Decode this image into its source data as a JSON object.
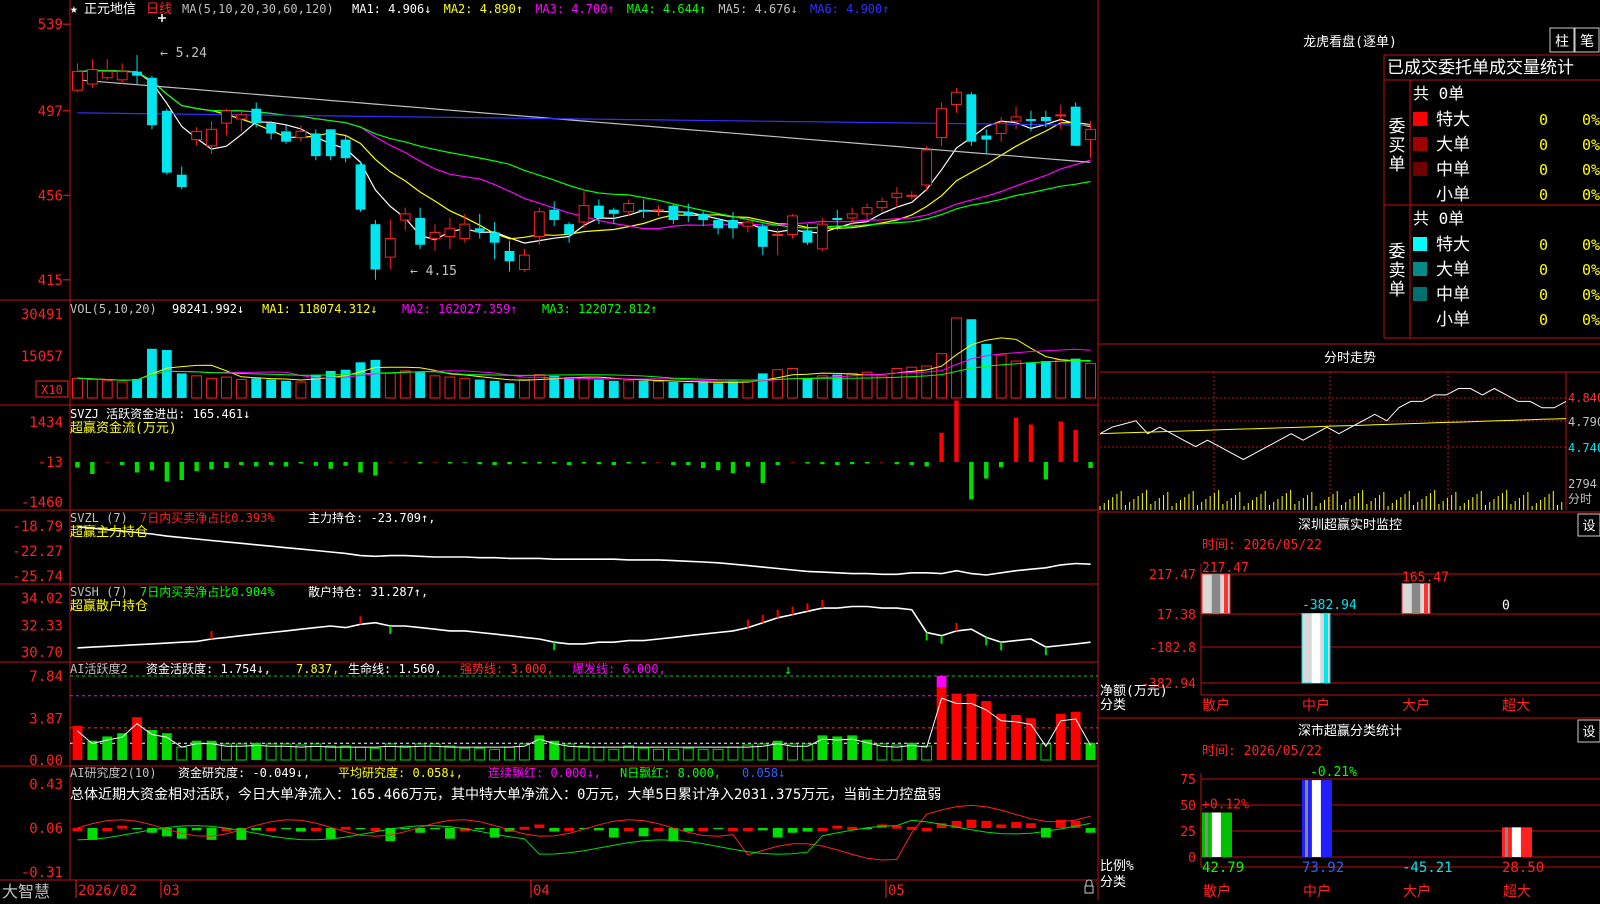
{
  "colors": {
    "bg": "#000000",
    "grid": "#c01010",
    "up": "#ff2020",
    "down": "#00e5ee",
    "text": "#c0c0c0",
    "yellow": "#ffff00",
    "white": "#ffffff",
    "green": "#00ff00",
    "magenta": "#ff00ff",
    "blue": "#3030ff"
  },
  "main": {
    "stock_name": "正元地信",
    "period": "日线",
    "ma_label": "MA(5,10,20,30,60,120)",
    "ma_values": [
      {
        "label": "MA1:",
        "value": "4.906",
        "arrow": "↓",
        "color": "#ffffff"
      },
      {
        "label": "MA2:",
        "value": "4.890",
        "arrow": "↑",
        "color": "#ffff00"
      },
      {
        "label": "MA3:",
        "value": "4.700",
        "arrow": "↑",
        "color": "#ff00ff"
      },
      {
        "label": "MA4:",
        "value": "4.644",
        "arrow": "↑",
        "color": "#00ff00"
      },
      {
        "label": "MA5:",
        "value": "4.676",
        "arrow": "↓",
        "color": "#c0c0c0"
      },
      {
        "label": "MA6:",
        "value": "4.900",
        "arrow": "↑",
        "color": "#3030ff"
      }
    ],
    "y_ticks": [
      "539",
      "497",
      "456",
      "415"
    ],
    "high_label": "5.24",
    "low_label": "4.15"
  },
  "vol": {
    "title": "VOL(5,10,20)",
    "value": "98241.992",
    "arrow": "↓",
    "ma1": "MA1: 118074.312",
    "ma1_arrow": "↓",
    "ma2": "MA2: 162027.359",
    "ma2_arrow": "↑",
    "ma3": "MA3: 122072.812",
    "ma3_arrow": "↑",
    "y_ticks": [
      "30491",
      "15057"
    ],
    "unit": "X10"
  },
  "svzj": {
    "title": "SVZJ  活跃资金进出: 165.461",
    "arrow": "↓",
    "subtitle": "超赢资金流(万元)",
    "y_ticks": [
      "1434",
      "-13",
      "-1460"
    ]
  },
  "svzl": {
    "title": "SVZL (7)",
    "part1": "7日内买卖净占比0.393%",
    "part2": "主力持仓: -23.709",
    "arrow": "↑,",
    "subtitle": "超赢主力持仓",
    "y_ticks": [
      "-18.79",
      "-22.27",
      "-25.74"
    ]
  },
  "svsh": {
    "title": "SVSH (7)",
    "part1": "7日内买卖净占比0.904%",
    "part2": "散户持仓: 31.287",
    "arrow": "↑,",
    "subtitle": "超赢散户持仓",
    "y_ticks": [
      "34.02",
      "32.33",
      "30.70"
    ]
  },
  "ai1": {
    "title": "AI活跃度2",
    "p1": "资金活跃度: 1.754",
    "a1": "↓,",
    "p2": "7.837,",
    "p3": "生命线: 1.560,",
    "p4": "强势线: 3.000,",
    "p5": "爆发线: 6.000,",
    "y_ticks": [
      "7.84",
      "3.87",
      "0.00"
    ]
  },
  "ai2": {
    "title": "AI研究度2(10)",
    "p1": "资金研究度: -0.049",
    "a1": "↓,",
    "p2": "平均研究度: 0.058",
    "a2": "↓,",
    "p3": "连续飘红: 0.000",
    "a3": "↓,",
    "p4": "N日飘红: 8.000,",
    "p5": "0.058",
    "a5": "↓",
    "summary": "总体近期大资金相对活跃，今日大单净流入：165.466万元，其中特大单净流入：0万元，大单5日累计净入2031.375万元，当前主力控盘弱",
    "y_ticks": [
      "0.43",
      "0.06",
      "-0.31"
    ]
  },
  "xaxis": {
    "brand": "大智慧",
    "labels": [
      "2026/02",
      "03",
      "04",
      "05"
    ]
  },
  "right": {
    "lhb_title": "龙虎看盘(逐单)",
    "tab_bar": "柱",
    "tab_note": "笔",
    "stats_title": "已成交委托单成交量统计",
    "buy": {
      "label": "委买单",
      "total": "共 0单",
      "rows": [
        {
          "name": "特大",
          "value": "0",
          "pct": "0%",
          "color": "#ff0000"
        },
        {
          "name": "大单",
          "value": "0",
          "pct": "0%",
          "color": "#a00000"
        },
        {
          "name": "中单",
          "value": "0",
          "pct": "0%",
          "color": "#700000"
        },
        {
          "name": "小单",
          "value": "0",
          "pct": "0%",
          "color": "#000000"
        }
      ]
    },
    "sell": {
      "label": "委卖单",
      "total": "共 0单",
      "rows": [
        {
          "name": "特大",
          "value": "0",
          "pct": "0%",
          "color": "#00ffff"
        },
        {
          "name": "大单",
          "value": "0",
          "pct": "0%",
          "color": "#008b8b"
        },
        {
          "name": "中单",
          "value": "0",
          "pct": "0%",
          "color": "#006f6f"
        },
        {
          "name": "小单",
          "value": "0",
          "pct": "0%",
          "color": "#000000"
        }
      ]
    },
    "fenshi": {
      "title": "分时走势",
      "y_ticks": [
        "4.840",
        "4.790",
        "4.740"
      ],
      "vol_tick": "2794",
      "vol_unit": "分时"
    },
    "monitor": {
      "title": "深圳超赢实时监控",
      "settings": "设",
      "date": "时间: 2026/05/22",
      "y_ticks": [
        "217.47",
        "17.38",
        "-182.8",
        "-382.94"
      ],
      "ylabel": "净额(万元)",
      "xlabel": "分类",
      "bars": [
        {
          "name": "散户",
          "value": 217.47,
          "label": "217.47"
        },
        {
          "name": "中户",
          "value": -382.94,
          "label": "-382.94"
        },
        {
          "name": "大户",
          "value": 165.47,
          "label": "165.47"
        },
        {
          "name": "超大",
          "value": 0,
          "label": "0"
        }
      ]
    },
    "classify": {
      "title": "深市超赢分类统计",
      "settings": "设",
      "date": "时间: 2026/05/22",
      "y_ticks": [
        "75",
        "50",
        "25",
        "0"
      ],
      "ylabel": "比例%",
      "xlabel": "分类",
      "bars": [
        {
          "name": "散户",
          "value": 42.79,
          "label": "42.79",
          "top": "+0.12%"
        },
        {
          "name": "中户",
          "value": 73.92,
          "label": "73.92",
          "top": "-0.21%"
        },
        {
          "name": "大户",
          "value": -45.21,
          "label": "-45.21",
          "top": ""
        },
        {
          "name": "超大",
          "value": 28.5,
          "label": "28.50",
          "top": ""
        }
      ]
    }
  },
  "chart_data": {
    "type": "candlestick",
    "title": "正元地信 日线",
    "ylim": [
      4.15,
      5.39
    ],
    "candles": [
      [
        5.07,
        5.16,
        5.2,
        5.06
      ],
      [
        5.1,
        5.17,
        5.22,
        5.08
      ],
      [
        5.13,
        5.16,
        5.22,
        5.12
      ],
      [
        5.12,
        5.16,
        5.2,
        5.1
      ],
      [
        5.16,
        5.14,
        5.24,
        5.1
      ],
      [
        5.13,
        4.9,
        5.14,
        4.88
      ],
      [
        4.97,
        4.67,
        4.98,
        4.66
      ],
      [
        4.66,
        4.6,
        4.7,
        4.59
      ],
      [
        4.83,
        4.87,
        4.89,
        4.8
      ],
      [
        4.8,
        4.88,
        4.92,
        4.76
      ],
      [
        4.91,
        4.97,
        4.98,
        4.85
      ],
      [
        4.93,
        4.95,
        4.97,
        4.87
      ],
      [
        4.98,
        4.91,
        5.01,
        4.89
      ],
      [
        4.91,
        4.86,
        4.92,
        4.83
      ],
      [
        4.87,
        4.82,
        4.9,
        4.81
      ],
      [
        4.84,
        4.87,
        4.9,
        4.82
      ],
      [
        4.86,
        4.75,
        4.88,
        4.73
      ],
      [
        4.88,
        4.75,
        4.88,
        4.73
      ],
      [
        4.83,
        4.74,
        4.85,
        4.72
      ],
      [
        4.71,
        4.49,
        4.72,
        4.48
      ],
      [
        4.42,
        4.2,
        4.44,
        4.15
      ],
      [
        4.26,
        4.35,
        4.44,
        4.2
      ],
      [
        4.44,
        4.47,
        4.5,
        4.39
      ],
      [
        4.45,
        4.32,
        4.5,
        4.3
      ],
      [
        4.35,
        4.38,
        4.42,
        4.29
      ],
      [
        4.36,
        4.4,
        4.45,
        4.3
      ],
      [
        4.35,
        4.42,
        4.47,
        4.33
      ],
      [
        4.4,
        4.38,
        4.47,
        4.35
      ],
      [
        4.38,
        4.33,
        4.43,
        4.25
      ],
      [
        4.29,
        4.24,
        4.34,
        4.19
      ],
      [
        4.2,
        4.27,
        4.3,
        4.19
      ],
      [
        4.36,
        4.48,
        4.5,
        4.32
      ],
      [
        4.49,
        4.44,
        4.53,
        4.41
      ],
      [
        4.42,
        4.37,
        4.43,
        4.33
      ],
      [
        4.43,
        4.51,
        4.58,
        4.4
      ],
      [
        4.51,
        4.45,
        4.54,
        4.42
      ],
      [
        4.49,
        4.47,
        4.5,
        4.42
      ],
      [
        4.48,
        4.52,
        4.54,
        4.46
      ],
      [
        4.49,
        4.48,
        4.54,
        4.45
      ],
      [
        4.49,
        4.49,
        4.51,
        4.46
      ],
      [
        4.51,
        4.44,
        4.52,
        4.42
      ],
      [
        4.48,
        4.46,
        4.52,
        4.43
      ],
      [
        4.47,
        4.44,
        4.48,
        4.41
      ],
      [
        4.44,
        4.4,
        4.45,
        4.37
      ],
      [
        4.44,
        4.4,
        4.48,
        4.35
      ],
      [
        4.41,
        4.43,
        4.45,
        4.38
      ],
      [
        4.41,
        4.31,
        4.42,
        4.27
      ],
      [
        4.37,
        4.37,
        4.4,
        4.27
      ],
      [
        4.37,
        4.46,
        4.47,
        4.35
      ],
      [
        4.39,
        4.33,
        4.42,
        4.32
      ],
      [
        4.3,
        4.42,
        4.45,
        4.29
      ],
      [
        4.45,
        4.44,
        4.49,
        4.39
      ],
      [
        4.45,
        4.47,
        4.5,
        4.41
      ],
      [
        4.47,
        4.5,
        4.52,
        4.44
      ],
      [
        4.5,
        4.53,
        4.55,
        4.48
      ],
      [
        4.55,
        4.57,
        4.6,
        4.5
      ],
      [
        4.56,
        4.56,
        4.58,
        4.54
      ],
      [
        4.61,
        4.78,
        4.8,
        4.58
      ],
      [
        4.84,
        4.98,
        5.01,
        4.8
      ],
      [
        5.0,
        5.06,
        5.08,
        4.96
      ],
      [
        5.05,
        4.82,
        5.06,
        4.8
      ],
      [
        4.85,
        4.83,
        4.88,
        4.76
      ],
      [
        4.86,
        4.91,
        4.94,
        4.82
      ],
      [
        4.92,
        4.94,
        4.99,
        4.88
      ],
      [
        4.93,
        4.92,
        4.97,
        4.87
      ],
      [
        4.94,
        4.92,
        4.97,
        4.89
      ],
      [
        4.95,
        4.95,
        5.0,
        4.88
      ],
      [
        4.99,
        4.8,
        5.01,
        4.8
      ],
      [
        4.83,
        4.88,
        4.92,
        4.74
      ]
    ],
    "volume": [
      160,
      150,
      140,
      130,
      155,
      400,
      390,
      200,
      180,
      160,
      170,
      150,
      160,
      150,
      140,
      130,
      190,
      220,
      230,
      290,
      310,
      200,
      220,
      210,
      180,
      170,
      160,
      150,
      140,
      120,
      150,
      190,
      180,
      170,
      160,
      150,
      140,
      145,
      140,
      135,
      130,
      120,
      130,
      120,
      140,
      135,
      200,
      230,
      240,
      160,
      180,
      190,
      200,
      210,
      180,
      240,
      250,
      260,
      360,
      650,
      640,
      440,
      350,
      300,
      290,
      300,
      310,
      320,
      280
    ],
    "svzj": [
      -75,
      -160,
      0,
      -40,
      -140,
      -110,
      -260,
      -240,
      -120,
      -100,
      -80,
      -40,
      -60,
      -40,
      -60,
      -20,
      -50,
      -90,
      -50,
      -140,
      -180,
      0,
      0,
      -20,
      0,
      -20,
      -10,
      -30,
      -40,
      -30,
      -20,
      -20,
      -20,
      -40,
      -20,
      -30,
      -40,
      -20,
      -20,
      0,
      -40,
      -40,
      -80,
      -110,
      -150,
      -60,
      -280,
      -40,
      0,
      -20,
      -30,
      -40,
      -30,
      -20,
      0,
      -30,
      -40,
      -60,
      390,
      820,
      -500,
      -220,
      -70,
      590,
      500,
      -230,
      540,
      430,
      -80
    ],
    "svzl": [
      -18.9,
      -19.1,
      -19.3,
      -19.5,
      -19.7,
      -19.9,
      -20.2,
      -20.4,
      -20.6,
      -20.8,
      -21.0,
      -21.2,
      -21.4,
      -21.6,
      -21.8,
      -22.0,
      -22.2,
      -22.4,
      -22.6,
      -22.9,
      -23.0,
      -22.9,
      -22.9,
      -23.0,
      -23.1,
      -23.1,
      -23.1,
      -23.2,
      -23.2,
      -23.3,
      -23.3,
      -23.3,
      -23.4,
      -23.4,
      -23.4,
      -23.4,
      -23.4,
      -23.5,
      -23.5,
      -23.5,
      -23.6,
      -23.7,
      -23.8,
      -23.9,
      -24.1,
      -24.3,
      -24.5,
      -24.7,
      -24.9,
      -25.1,
      -25.2,
      -25.3,
      -25.4,
      -25.4,
      -25.5,
      -25.5,
      -25.3,
      -25.3,
      -25.4,
      -25.0,
      -25.4,
      -25.6,
      -25.3,
      -25.0,
      -24.8,
      -24.6,
      -24.2,
      -24.0,
      -24.1
    ],
    "svsh": [
      30.95,
      31.0,
      31.05,
      31.1,
      31.15,
      31.2,
      31.25,
      31.3,
      31.35,
      31.5,
      31.6,
      31.7,
      31.8,
      31.9,
      32.0,
      32.1,
      32.2,
      32.3,
      32.2,
      32.4,
      32.5,
      32.3,
      32.3,
      32.2,
      32.1,
      32.0,
      32.0,
      31.9,
      31.8,
      31.7,
      31.6,
      31.5,
      31.3,
      31.2,
      31.2,
      31.3,
      31.3,
      31.4,
      31.4,
      31.5,
      31.6,
      31.7,
      31.8,
      31.9,
      32.0,
      32.2,
      32.5,
      32.8,
      33.0,
      33.2,
      33.4,
      33.4,
      33.5,
      33.5,
      33.4,
      33.4,
      33.3,
      31.9,
      31.7,
      32.0,
      32.1,
      31.6,
      31.3,
      31.4,
      31.5,
      31.0,
      31.1,
      31.2,
      31.3
    ],
    "ai1": [
      3.2,
      1.8,
      2.2,
      2.5,
      4.0,
      2.8,
      2.5,
      1.2,
      1.8,
      1.8,
      1.5,
      1.5,
      1.6,
      1.5,
      1.5,
      1.4,
      1.5,
      1.3,
      1.3,
      1.2,
      1.1,
      1.5,
      1.3,
      1.5,
      1.5,
      1.3,
      1.1,
      1.1,
      1.0,
      1.2,
      1.5,
      2.3,
      1.8,
      1.5,
      1.3,
      1.2,
      1.0,
      1.3,
      1.1,
      1.0,
      1.0,
      1.1,
      1.0,
      1.0,
      1.2,
      1.4,
      1.5,
      1.8,
      1.5,
      1.5,
      2.3,
      2.2,
      2.3,
      1.9,
      1.5,
      1.4,
      1.6,
      1.3,
      6.8,
      6.2,
      6.2,
      5.5,
      4.3,
      4.2,
      3.9,
      1.5,
      4.3,
      4.5,
      1.6
    ],
    "ai2": [
      0.06,
      -0.04,
      0.06,
      0.08,
      0.05,
      0.02,
      -0.01,
      -0.03,
      0.04,
      -0.04,
      0.06,
      -0.04,
      0.04,
      0.06,
      0.05,
      0.03,
      0.06,
      -0.03,
      0.07,
      0.05,
      0.06,
      -0.05,
      0.05,
      0.02,
      0.05,
      -0.03,
      0.06,
      0.05,
      -0.02,
      0.03,
      0.07,
      0.09,
      0.03,
      0.06,
      0.05,
      0.04,
      -0.02,
      0.06,
      -0.01,
      0.06,
      -0.05,
      0.03,
      0.06,
      0.05,
      0.06,
      0.06,
      0.04,
      -0.02,
      0.02,
      0.03,
      0.06,
      0.08,
      0.07,
      0.05,
      0.09,
      0.08,
      0.07,
      0.06,
      0.1,
      0.12,
      0.13,
      0.12,
      0.09,
      0.11,
      0.1,
      -0.02,
      0.13,
      0.12,
      0.02
    ]
  }
}
